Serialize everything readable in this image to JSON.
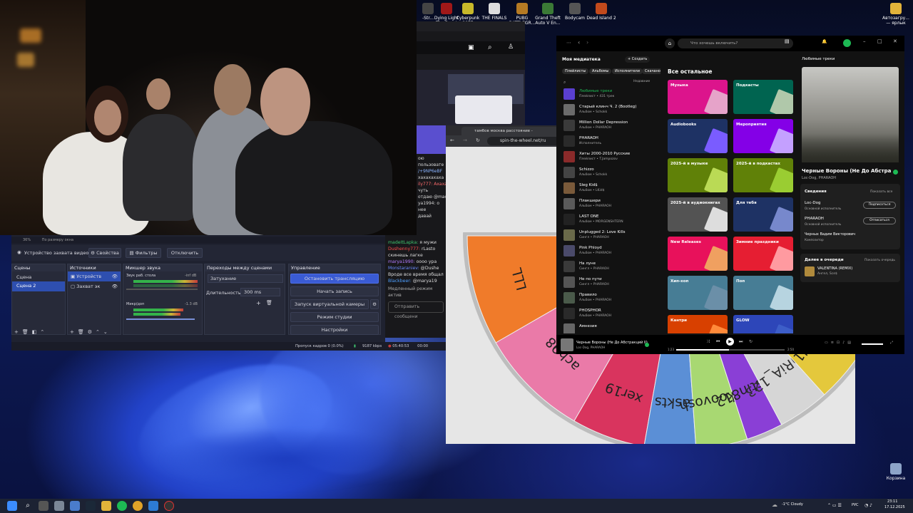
{
  "desktop_icons": [
    "Dying Light The Beast",
    "Cyberpunk 2077",
    "THE FINALS",
    "PUBG BATTLEGR...",
    "Grand Theft Auto V En...",
    "Bodycam",
    "Dead Island 2",
    "Автозагру... — ярлык",
    "Корзина"
  ],
  "obs": {
    "top_bar": "36%",
    "fit_label": "По размеру окна",
    "device_label": "Устройство захвата видео",
    "props_btn": "Свойства",
    "filters_btn": "Фильтры",
    "disable_btn": "Отключить",
    "scenes_title": "Сцены",
    "scenes": [
      "Сцена",
      "Сцена 2"
    ],
    "sources_title": "Источники",
    "sources": [
      "Устройств",
      "Захват эк"
    ],
    "mixer_title": "Микшер звука",
    "mixer_ch1": "Звук раб. стола",
    "mixer_ch1_db": "-inf dB",
    "mixer_ch2": "Микр/доп",
    "mixer_ch2_db": "-1.3 dB",
    "transitions_title": "Переходы между сценами",
    "transition_value": "Затухание",
    "duration_label": "Длительность",
    "duration_value": "300 ms",
    "controls_title": "Управление",
    "btn_stop_stream": "Остановить трансляцию",
    "btn_record": "Начать запись",
    "btn_virtual_cam": "Запуск виртуальной камеры",
    "btn_studio": "Режим студии",
    "btn_settings": "Настройки",
    "status_dropped": "Пропуск кадров 0 (0.0%)",
    "status_kbps": "9187 kbps",
    "status_time": "05:40:53",
    "status_time2": "00:00"
  },
  "chat": {
    "lines": [
      {
        "user": "madeItLapka:",
        "text": "я мужи"
      },
      {
        "user": "Dushenny777:",
        "text": "rLasto скинешь лагке"
      },
      {
        "user": "marya1990:",
        "text": "оооо ура"
      },
      {
        "user": "Monstaraniev:",
        "text": "@Dushe Вроде все время общал"
      },
      {
        "user": "Blackbeer:",
        "text": "@marya19"
      }
    ],
    "slow_mode": "Медленный режим актив",
    "send_placeholder": "Отправить сообщени",
    "partial": [
      "ою пользовате",
      "/+9NP6eBF",
      "хахахахаха",
      "ily777: Ахаха",
      "чуть",
      "отдаю @mac",
      "ya1994: о нее",
      "давай"
    ]
  },
  "browser": {
    "tab_title": "тамбов москва расстояние - ",
    "url": "spin-the-wheel.net/ru",
    "wheel_labels": [
      "LLL",
      "ach98",
      "xer19",
      "askts",
      "alkoovosh",
      "Fostin812",
      "DaRiA_123",
      "eskod1"
    ]
  },
  "spotify": {
    "search_placeholder": "Что хочешь включить?",
    "library_title": "Моя медиатека",
    "create_btn": "Создать",
    "filters": [
      "Плейлисты",
      "Альбомы",
      "Исполнители",
      "Скачано"
    ],
    "sort": "Недавние",
    "items": [
      {
        "t": "Любимые треки",
        "s": "Плейлист • 431 трек"
      },
      {
        "t": "Старый клинч Ч. 2 (Bootleg)",
        "s": "Альбом • Schokk"
      },
      {
        "t": "Million Dollar Depression",
        "s": "Альбом • PHARAOH"
      },
      {
        "t": "PHARAOH",
        "s": "Исполнитель"
      },
      {
        "t": "Хиты 2000-2010 Русские",
        "s": "Плейлист • T.Jampozov"
      },
      {
        "t": "Schizzo",
        "s": "Альбом • Schokk"
      },
      {
        "t": "Sleg Kid$",
        "s": "Альбом • LKid$"
      },
      {
        "t": "Плакшери",
        "s": "Альбом • PHARAOH"
      },
      {
        "t": "LAST ONE",
        "s": "Альбом • MORGENSHTERN"
      },
      {
        "t": "Unplugged 2: Love Kills",
        "s": "Сингл • PHARAOH"
      },
      {
        "t": "Pink Phloyd",
        "s": "Альбом • PHARAOH"
      },
      {
        "t": "На луне",
        "s": "Сингл • PHARAOH"
      },
      {
        "t": "Не по пути",
        "s": "Сингл • PHARAOH"
      },
      {
        "t": "Правило",
        "s": "Альбом • PHARAOH"
      },
      {
        "t": "PHOSPHOR",
        "s": "Альбом • PHARAOH"
      },
      {
        "t": "Амнезия",
        "s": ""
      }
    ],
    "browse_title": "Все остальное",
    "categories": [
      {
        "name": "Музыка",
        "color": "#dc148c"
      },
      {
        "name": "Подкасты",
        "color": "#006450"
      },
      {
        "name": "Audiobooks",
        "color": "#1e3264"
      },
      {
        "name": "Мероприятия",
        "color": "#8400e7"
      },
      {
        "name": "2025-й в музыке",
        "color": "#608108"
      },
      {
        "name": "2025-й в подкастах",
        "color": "#608108"
      },
      {
        "name": "2025-й в аудиокнигах",
        "color": "#535353"
      },
      {
        "name": "Для тебя",
        "color": "#1e3264"
      },
      {
        "name": "New Releases",
        "color": "#e8115b"
      },
      {
        "name": "Зимние праздники",
        "color": "#e61e32"
      },
      {
        "name": "Хип-хоп",
        "color": "#477d95"
      },
      {
        "name": "Поп",
        "color": "#477d95"
      },
      {
        "name": "Кантри",
        "color": "#d84000"
      },
      {
        "name": "GLOW",
        "color": "#2d46b9"
      }
    ],
    "right_header": "Любимые треки",
    "now_title": "Черные Вороны (Не До Абстра",
    "now_artist": "Loc-Dog, PHARAOH",
    "credits_title": "Сведения",
    "credits_show": "Показать все",
    "credits": [
      {
        "name": "Loc-Dog",
        "role": "Основной исполнитель",
        "btn": "Подписаться"
      },
      {
        "name": "PHARAOH",
        "role": "Основной исполнитель",
        "btn": "Отписаться"
      },
      {
        "name": "Черных Вадим Викторович",
        "role": "Композитор",
        "btn": ""
      }
    ],
    "queue_title": "Далее в очереди",
    "queue_open": "Показать очередь",
    "queue_item": "VALENTINA (REMIX)",
    "queue_artist": "Ангел, Sce$",
    "player_title": "Черные Вороны (Не До Абстракций II)",
    "player_artist": "Loc-Dog, PHARAOH",
    "time_start": "1:23",
    "time_end": "2:50"
  },
  "taskbar": {
    "weather": "-1°C Cloudy",
    "lang": "РУС",
    "time": "23:11",
    "date": "17.12.2025"
  }
}
